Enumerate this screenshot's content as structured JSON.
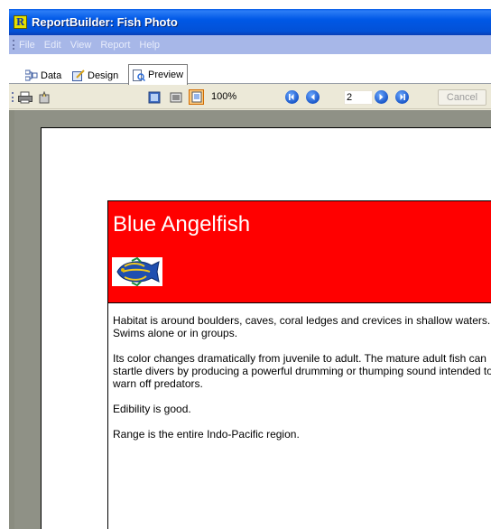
{
  "window": {
    "title": "ReportBuilder: Fish Photo",
    "app_icon_letter": "R"
  },
  "menu": [
    "File",
    "Edit",
    "View",
    "Report",
    "Help"
  ],
  "tabs": [
    {
      "label": "Data",
      "icon": "data-icon"
    },
    {
      "label": "Design",
      "icon": "design-icon"
    },
    {
      "label": "Preview",
      "icon": "preview-icon",
      "active": true
    }
  ],
  "toolbar": {
    "zoom": "100%",
    "page_number": "2",
    "cancel_label": "Cancel"
  },
  "report": {
    "title": "Blue Angelfish",
    "paragraphs": [
      "Habitat is around boulders, caves, coral ledges and crevices in shallow waters.  Swims alone or in groups.",
      "Its color changes dramatically from juvenile to adult.  The mature adult fish can startle divers by producing a powerful drumming or thumping sound intended to warn off predators.",
      "Edibility is good.",
      "Range is the entire Indo-Pacific region."
    ]
  },
  "colors": {
    "title_bar": "#0058e6",
    "menu_bar": "#a7b7e8",
    "header_band": "#ff0000",
    "preview_bg": "#8f9186"
  }
}
